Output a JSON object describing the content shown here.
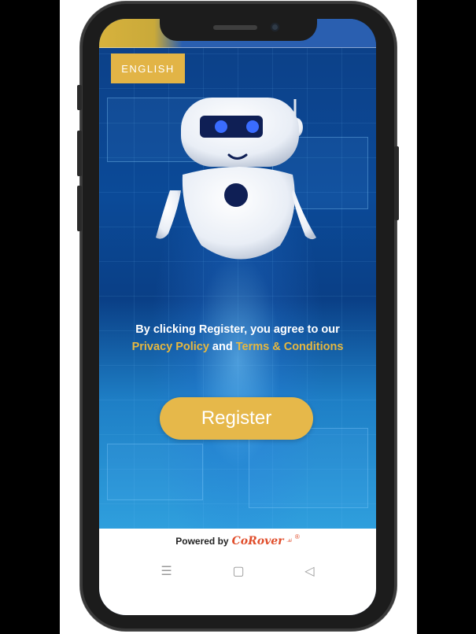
{
  "language_button": {
    "label": "ENGLISH"
  },
  "agreement": {
    "prefix": "By clicking Register, you agree to our ",
    "privacy": "Privacy Policy",
    "and": " and ",
    "terms": "Terms & Conditions"
  },
  "register_button": {
    "label": "Register"
  },
  "footer": {
    "powered_by": "Powered by",
    "brand": "CoRover",
    "brand_sub": ".ai",
    "registered": "®"
  },
  "nav": {
    "menu": "☰",
    "home": "▢",
    "back": "◁"
  },
  "colors": {
    "accent": "#e6b84a",
    "link": "#e7b83f",
    "brand": "#e04e2c",
    "bg_blue": "#0b4a98"
  }
}
